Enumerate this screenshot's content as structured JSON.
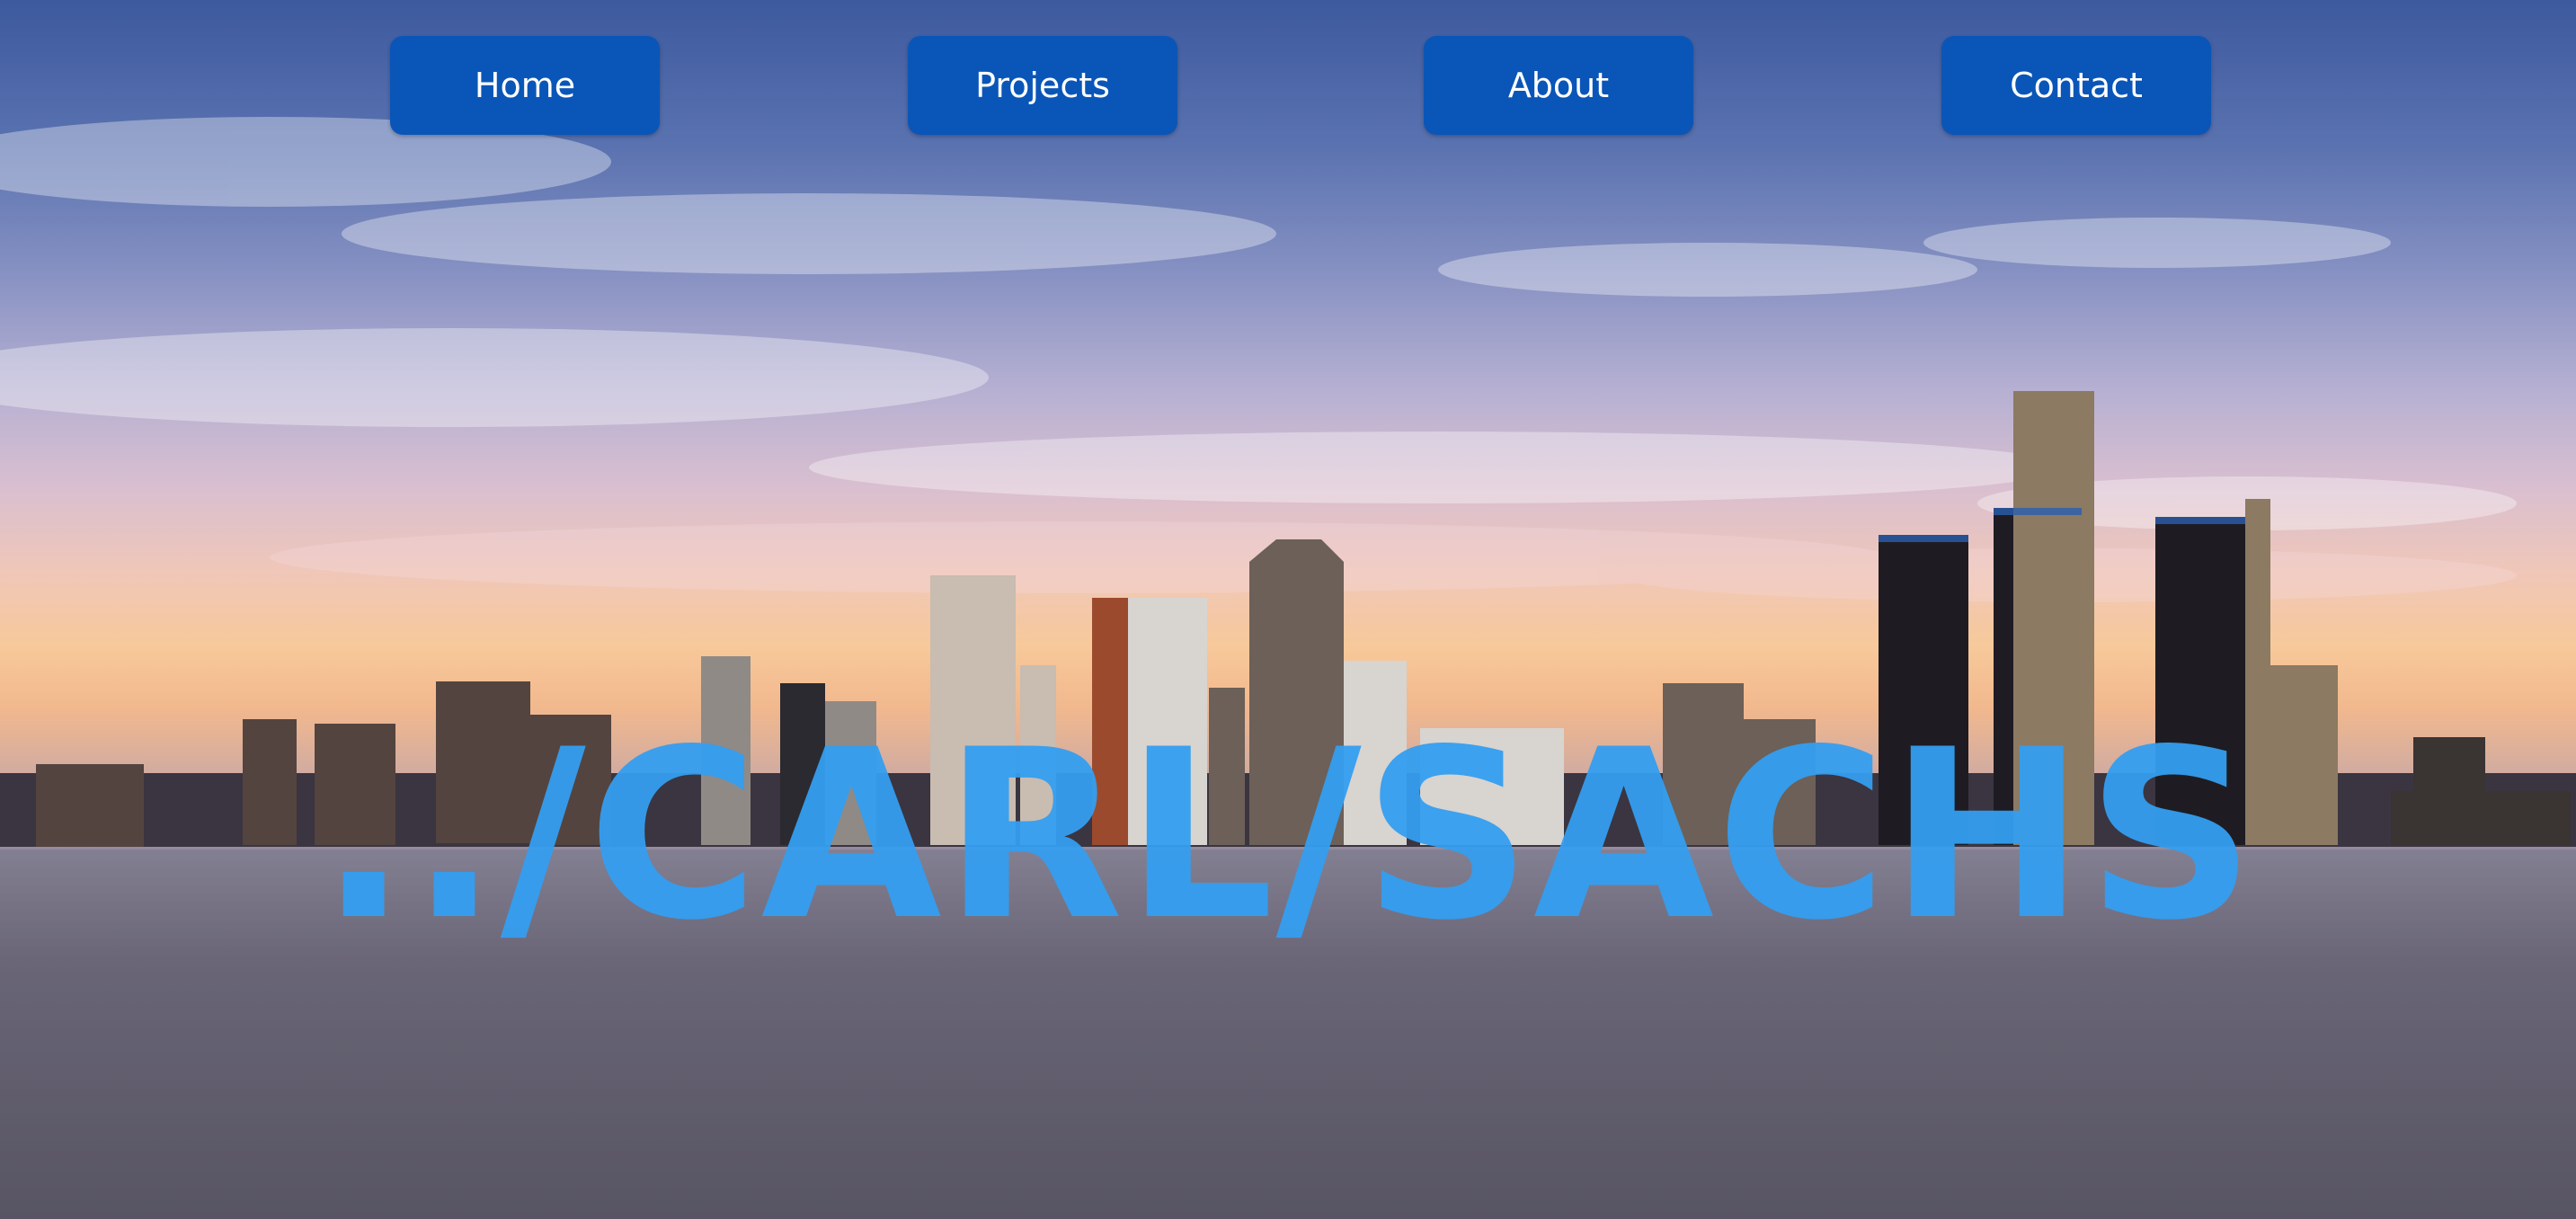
{
  "nav": {
    "items": [
      {
        "label": "Home"
      },
      {
        "label": "Projects"
      },
      {
        "label": "About"
      },
      {
        "label": "Contact"
      }
    ]
  },
  "hero": {
    "title": "../CARL/SACHS"
  },
  "colors": {
    "nav_button_bg": "#0a56b8",
    "nav_button_text": "#ffffff",
    "title_color": "#349ef0"
  }
}
